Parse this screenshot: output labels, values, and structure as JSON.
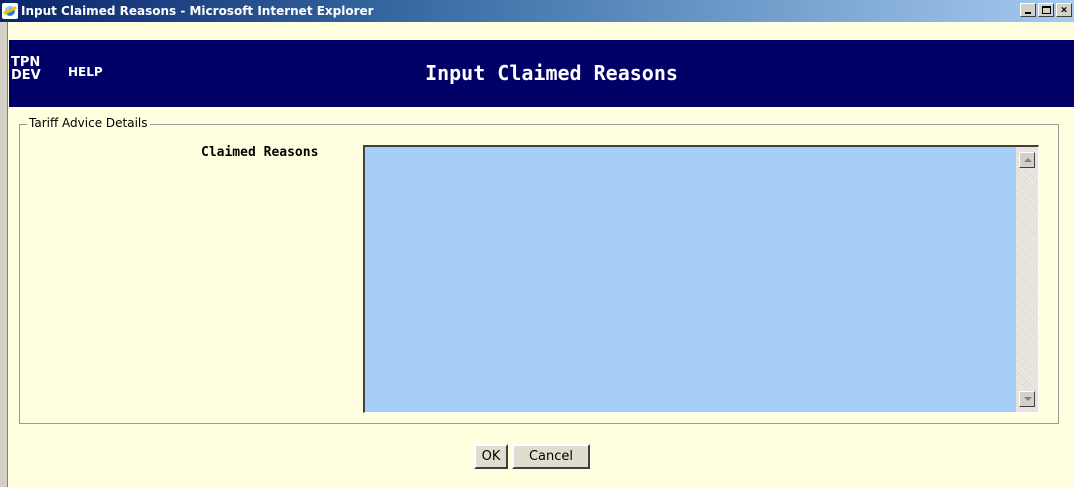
{
  "window": {
    "title": "Input Claimed Reasons - Microsoft Internet Explorer",
    "minimize_symbol": "_",
    "maximize_symbol": "□",
    "close_symbol": "×"
  },
  "header": {
    "brand_line1": "TPN",
    "brand_line2": "DEV",
    "help_label": "HELP",
    "page_title": "Input Claimed Reasons"
  },
  "details": {
    "legend": "Tariff Advice Details",
    "claimed_reasons_label": "Claimed Reasons",
    "claimed_reasons_value": ""
  },
  "buttons": {
    "ok_label": "OK",
    "cancel_label": "Cancel"
  },
  "colors": {
    "header_background": "#000066",
    "page_background": "#ffffe0",
    "textarea_background": "#a6cef6"
  }
}
